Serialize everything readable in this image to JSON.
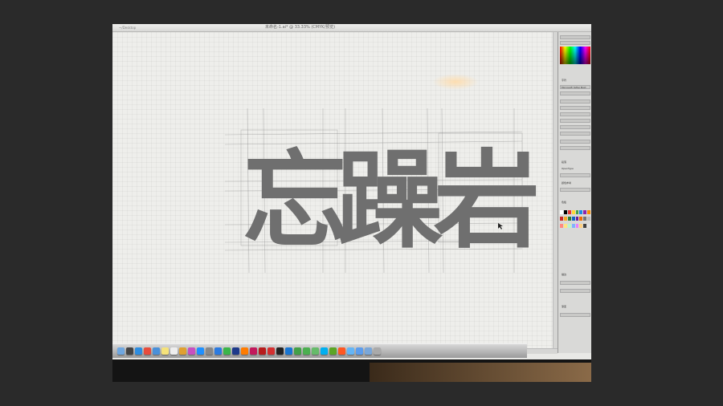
{
  "window": {
    "title": "未命名-1.ai* @ 33.33% (CMYK/预览)",
    "path": "~/Desktop"
  },
  "artwork": {
    "glyphs": [
      "忘",
      "躁",
      "岩"
    ],
    "colors": {
      "glyph": "#6f6f6f",
      "canvas": "#eeeeeb",
      "guides": "#888888"
    }
  },
  "panels": {
    "font_family": "Microsoft YaHei Bold",
    "labels": [
      "字符",
      "段落",
      "OpenType",
      "颜色参考",
      "色板",
      "描边",
      "渐变"
    ]
  },
  "dock": {
    "icons": [
      "finder-icon",
      "dashboard-icon",
      "safari-icon",
      "chrome-icon",
      "mail-icon",
      "notes-icon",
      "calendar-icon",
      "photos-icon",
      "itunes-icon",
      "appstore-icon",
      "preferences-icon",
      "qq-icon",
      "wechat-icon",
      "photoshop-icon",
      "illustrator-icon",
      "indesign-icon",
      "flash-icon",
      "acrobat-icon",
      "terminal-icon",
      "xcode-icon",
      "maps-icon",
      "facetime-icon",
      "messages-icon",
      "skype-icon",
      "evernote-icon",
      "music-icon",
      "folder-icon",
      "downloads-icon",
      "documents-icon",
      "trash-icon"
    ],
    "icon_colors": [
      "#6fa7e0",
      "#444",
      "#2d8de0",
      "#e74c3c",
      "#4a90d9",
      "#f5e27a",
      "#eee",
      "#e0a030",
      "#c850c0",
      "#1e90ff",
      "#888",
      "#2c7be0",
      "#3bb54a",
      "#1e3a8a",
      "#ff7c00",
      "#c2185b",
      "#b71c1c",
      "#d32f2f",
      "#222",
      "#1976d2",
      "#43a047",
      "#4caf50",
      "#66bb6a",
      "#00aff0",
      "#5ba525",
      "#ff5722",
      "#64b5f6",
      "#5c9ded",
      "#7aa7d9",
      "#aaaaaa"
    ]
  }
}
